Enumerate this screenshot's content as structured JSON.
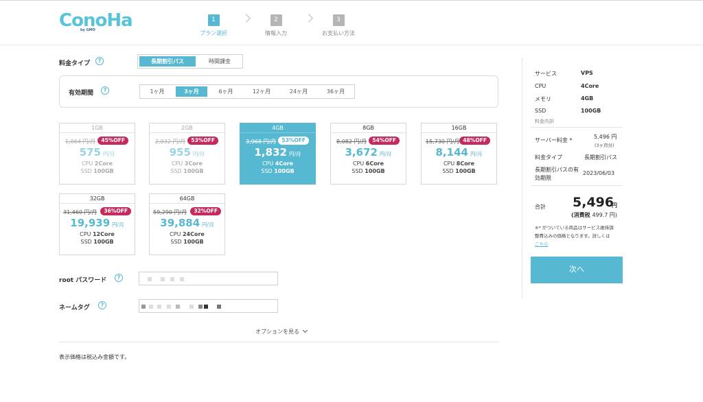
{
  "header": {
    "logo": "ConoHa",
    "logo_sub": "by GMO",
    "steps": [
      {
        "num": "1",
        "label": "プラン選択"
      },
      {
        "num": "2",
        "label": "情報入力"
      },
      {
        "num": "3",
        "label": "お支払い方法"
      }
    ]
  },
  "fee_type": {
    "label": "料金タイプ",
    "options": [
      "長期割引パス",
      "時間課金"
    ]
  },
  "period": {
    "label": "有効期間",
    "options": [
      "1ヶ月",
      "3ヶ月",
      "6ヶ月",
      "12ヶ月",
      "24ヶ月",
      "36ヶ月"
    ]
  },
  "plans": [
    {
      "name": "1GB",
      "old": "1,064 円/月",
      "off": "45%OFF",
      "price": "575",
      "unit": "円/月",
      "cpu_label": "CPU",
      "cpu": "2Core",
      "ssd_label": "SSD",
      "ssd": "100GB"
    },
    {
      "name": "2GB",
      "old": "2,032 円/月",
      "off": "53%OFF",
      "price": "955",
      "unit": "円/月",
      "cpu_label": "CPU",
      "cpu": "3Core",
      "ssd_label": "SSD",
      "ssd": "100GB"
    },
    {
      "name": "4GB",
      "old": "3,968 円/月",
      "off": "53%OFF",
      "price": "1,832",
      "unit": "円/月",
      "cpu_label": "CPU",
      "cpu": "4Core",
      "ssd_label": "SSD",
      "ssd": "100GB"
    },
    {
      "name": "8GB",
      "old": "8,082 円/月",
      "off": "54%OFF",
      "price": "3,672",
      "unit": "円/月",
      "cpu_label": "CPU",
      "cpu": "6Core",
      "ssd_label": "SSD",
      "ssd": "100GB"
    },
    {
      "name": "16GB",
      "old": "15,730 円/月",
      "off": "48%OFF",
      "price": "8,144",
      "unit": "円/月",
      "cpu_label": "CPU",
      "cpu": "8Core",
      "ssd_label": "SSD",
      "ssd": "100GB"
    },
    {
      "name": "32GB",
      "old": "31,460 円/月",
      "off": "36%OFF",
      "price": "19,939",
      "unit": "円/月",
      "cpu_label": "CPU",
      "cpu": "12Core",
      "ssd_label": "SSD",
      "ssd": "100GB"
    },
    {
      "name": "64GB",
      "old": "59,290 円/月",
      "off": "32%OFF",
      "price": "39,884",
      "unit": "円/月",
      "cpu_label": "CPU",
      "cpu": "24Core",
      "ssd_label": "SSD",
      "ssd": "100GB"
    }
  ],
  "root_password": {
    "label": "root パスワード"
  },
  "name_tag": {
    "label": "ネームタグ"
  },
  "options_link": "オプションを見る",
  "footnote": "表示価格は税込み金額です。",
  "summary": {
    "rows": [
      {
        "key": "サービス",
        "value": "VPS"
      },
      {
        "key": "CPU",
        "value": "4Core"
      },
      {
        "key": "メモリ",
        "value": "4GB"
      },
      {
        "key": "SSD",
        "value": "100GB"
      }
    ],
    "breakdown_title": "料金内訳",
    "server_fee_label": "サーバー料金 *",
    "server_fee_value": "5,496 円",
    "server_fee_note": "(3ヶ月分)",
    "fee_type_label": "料金タイプ",
    "fee_type_value": "長期割引パス",
    "expiry_label_1": "長期割引パスの有",
    "expiry_label_2": "効期限",
    "expiry_value": "2023/06/03",
    "total_label": "合計",
    "total_value": "5,496",
    "total_unit": "円",
    "tax_label": "(消費税 ",
    "tax_value": "499.7 円)",
    "note_1": "※* がついている商品はサービス維持調",
    "note_2": "整費込みの価格となります。詳しくは",
    "note_link": "こちら",
    "next_button": "次へ"
  },
  "colors": {
    "accent": "#57b8d1",
    "discount": "#c52a5c"
  }
}
